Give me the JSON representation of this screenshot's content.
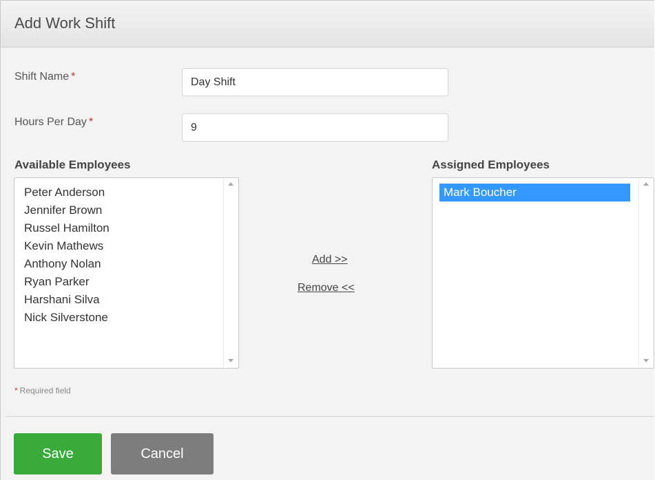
{
  "dialog": {
    "title": "Add Work Shift"
  },
  "form": {
    "shift_name": {
      "label": "Shift Name",
      "required_marker": "*",
      "value": "Day Shift"
    },
    "hours_per_day": {
      "label": "Hours Per Day",
      "required_marker": "*",
      "value": "9"
    }
  },
  "available_employees": {
    "label": "Available Employees",
    "items": [
      "Peter Anderson",
      "Jennifer Brown",
      "Russel Hamilton",
      "Kevin Mathews",
      "Anthony Nolan",
      "Ryan Parker",
      "Harshani Silva",
      "Nick Silverstone"
    ]
  },
  "assigned_employees": {
    "label": "Assigned Employees",
    "items": [
      "Mark Boucher"
    ],
    "selected": "Mark Boucher"
  },
  "actions": {
    "add_label": "Add >>",
    "remove_label": "Remove <<",
    "save_label": "Save",
    "cancel_label": "Cancel"
  },
  "footer": {
    "required_marker": "*",
    "required_note": "Required field"
  },
  "colors": {
    "accent_save": "#3aaa3a",
    "cancel_gray": "#7d7d7d",
    "required_red": "#c0392b",
    "selection_blue": "#3399ff"
  },
  "icons": {
    "scroll_up": "scroll-up-arrow-icon",
    "scroll_down": "scroll-down-arrow-icon"
  }
}
